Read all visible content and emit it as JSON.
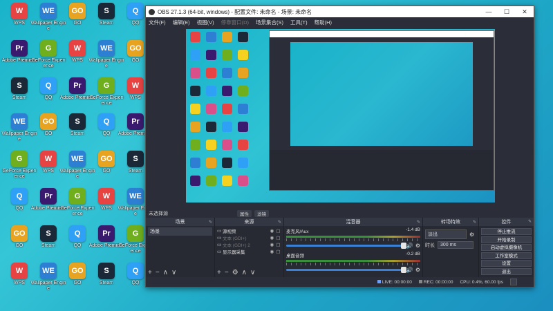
{
  "desktop": {
    "icons": [
      {
        "label": "WPS",
        "color": "#e84343",
        "glyph": "W"
      },
      {
        "label": "Wallpaper Engine",
        "color": "#2d7fd3",
        "glyph": "WE"
      },
      {
        "label": "GO",
        "color": "#e8a420",
        "glyph": "GO"
      },
      {
        "label": "Steam",
        "color": "#1b2838",
        "glyph": "S"
      },
      {
        "label": "QQ",
        "color": "#2ea0f5",
        "glyph": "Q"
      },
      {
        "label": "Adobe Premiere",
        "color": "#3a1a6e",
        "glyph": "Pr"
      },
      {
        "label": "GeForce Experience",
        "color": "#6fae1d",
        "glyph": "G"
      }
    ]
  },
  "obs": {
    "title": "OBS 27.1.3 (64-bit, windows) - 配置文件: 未命名 - 场景: 未命名",
    "menu": [
      "文件(F)",
      "编辑(E)",
      "视图(V)",
      "停靠窗口(D)",
      "场景集合(S)",
      "工具(T)",
      "帮助(H)"
    ],
    "scene_bar": {
      "label": "未选择源",
      "btn_props": "属性",
      "btn_filters": "滤镜"
    },
    "scenes": {
      "title": "场景",
      "items": [
        "场景"
      ]
    },
    "sources": {
      "title": "来源",
      "items": [
        {
          "name": "源视频",
          "dim": false
        },
        {
          "name": "文本 (GDI+)",
          "dim": true
        },
        {
          "name": "文本 (GDI+) 2",
          "dim": true
        },
        {
          "name": "显示器采集",
          "dim": false
        }
      ]
    },
    "mixer": {
      "title": "混音器",
      "channels": [
        {
          "name": "麦克风/Aux",
          "db": "-1.4 dB"
        },
        {
          "name": "桌面音频",
          "db": "-0.2 dB"
        }
      ]
    },
    "transitions": {
      "title": "转场特效",
      "selected": "淡出",
      "duration_label": "时长",
      "duration_value": "300 ms"
    },
    "controls": {
      "title": "控件",
      "buttons": [
        "停止推流",
        "开始录制",
        "启动虚拟摄像机",
        "工作室模式",
        "设置",
        "退出"
      ]
    },
    "status": {
      "live": "LIVE: 00:00:00",
      "rec": "REC: 00:00:00",
      "cpu": "CPU: 0.4%, 60.00 fps"
    }
  }
}
